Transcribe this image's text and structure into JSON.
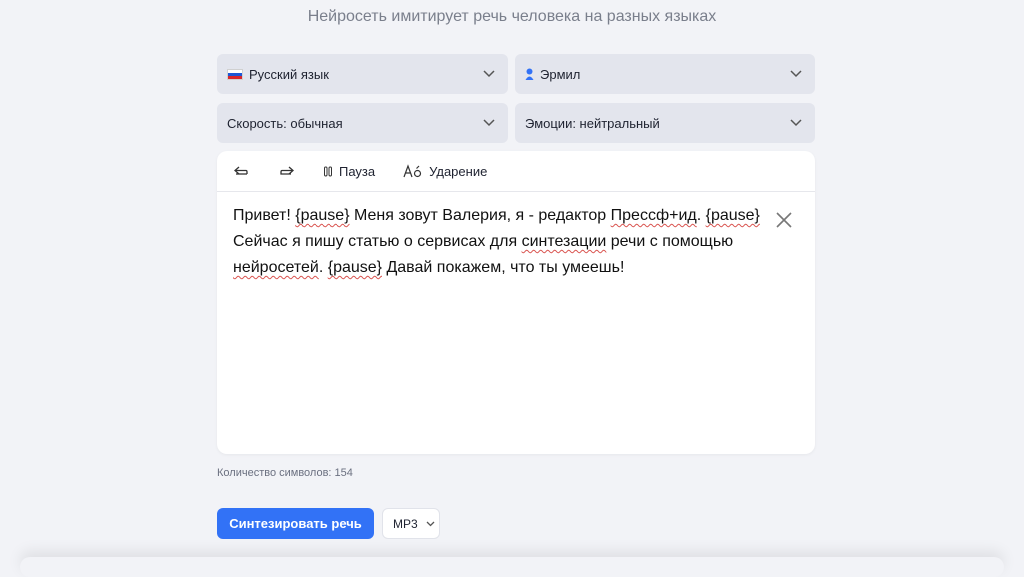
{
  "header": {
    "subtitle": "Нейросеть имитирует речь человека на разных языках"
  },
  "selects": {
    "language": {
      "value": "Русский язык",
      "icon": "russia-flag-icon"
    },
    "voice": {
      "value": "Эрмил",
      "icon": "voice-person-icon"
    },
    "speed": {
      "value": "Скорость: обычная"
    },
    "emotion": {
      "value": "Эмоции: нейтральный"
    }
  },
  "toolbar": {
    "undo_icon": "undo-icon",
    "redo_icon": "redo-icon",
    "pause_label": "Пауза",
    "stress_label": "Ударение"
  },
  "editor": {
    "t1": "Привет! ",
    "t2": "{pause}",
    "t3": " Меня зовут Валерия, я - редактор ",
    "t4": "Прессф+ид",
    "t5": ". ",
    "t6": "{pause}",
    "t7": " Сейчас я пишу статью о сервисах для ",
    "t8": "синтезации",
    "t9": " речи с помощью ",
    "t10": "нейросетей",
    "t11": ". ",
    "t12": "{pause}",
    "t13": " Давай покажем, что ты умеешь!"
  },
  "counter": "Количество символов: 154",
  "actions": {
    "synthesize_label": "Синтезировать речь",
    "format_value": "MP3"
  },
  "colors": {
    "accent": "#3272f6",
    "background": "#f2f3f7",
    "select_bg": "#e3e5ed"
  }
}
